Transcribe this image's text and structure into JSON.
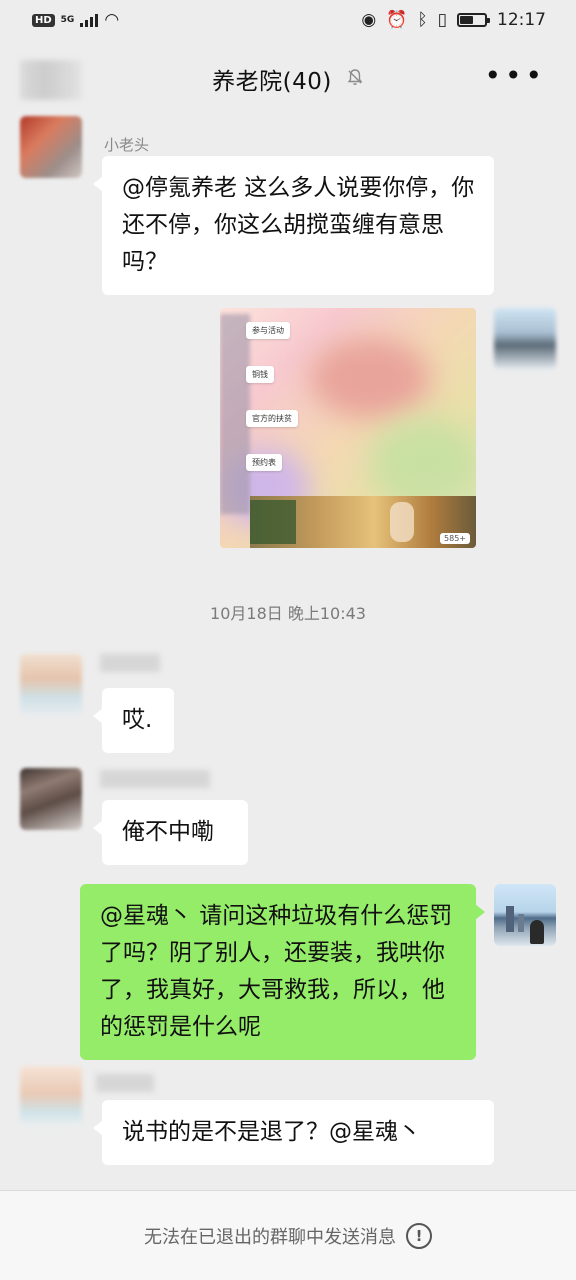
{
  "status_bar": {
    "hd": "HD",
    "network": "5G",
    "time": "12:17",
    "battery_level": 0.55,
    "icons": [
      "eye-icon",
      "alarm-icon",
      "bluetooth-icon",
      "vibrate-icon",
      "battery-icon"
    ]
  },
  "header": {
    "title": "养老院(40)",
    "mute_icon": "bell-off-icon",
    "more_icon": "more-dots-icon"
  },
  "messages": [
    {
      "side": "left",
      "sender": "小老头",
      "text": "@停氪养老  这么多人说要你停，你还不停，你这么胡搅蛮缠有意思吗？"
    },
    {
      "side": "right",
      "type": "image",
      "menu_items": [
        "参与活动",
        "铜钱",
        "官方的扶贫",
        "预约表"
      ],
      "game_menu": [
        "",
        ""
      ],
      "badge": "585+"
    },
    {
      "type": "timestamp",
      "text": "10月18日 晚上10:43"
    },
    {
      "side": "left",
      "sender": "",
      "text": "哎."
    },
    {
      "side": "left",
      "sender": "",
      "text": "俺不中嘞"
    },
    {
      "side": "right",
      "text": "@星魂丶  请问这种垃圾有什么惩罚了吗？阴了别人，还要装，我哄你了，我真好，大哥救我，所以，他的惩罚是什么呢"
    },
    {
      "side": "left",
      "sender": "",
      "text": "说书的是不是退了？@星魂丶"
    }
  ],
  "bottom_bar": {
    "notice": "无法在已退出的群聊中发送消息",
    "icon": "info-icon"
  },
  "colors": {
    "background": "#ededed",
    "bubble_self": "#95ec69",
    "bubble_other": "#ffffff"
  }
}
